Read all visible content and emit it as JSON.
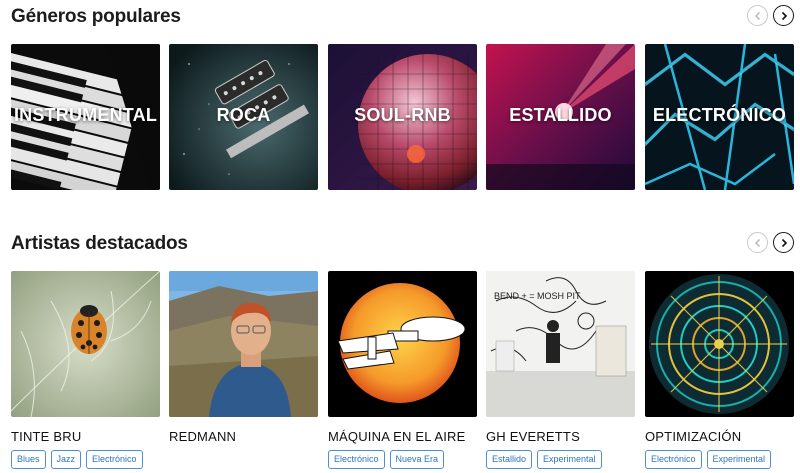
{
  "genres": {
    "title": "Géneros populares",
    "items": [
      {
        "label": "INSTRUMENTAL",
        "icon": "piano-image"
      },
      {
        "label": "ROCA",
        "icon": "guitar-image"
      },
      {
        "label": "SOUL-RNB",
        "icon": "disco-ball-image"
      },
      {
        "label": "ESTALLIDO",
        "icon": "concert-light-image"
      },
      {
        "label": "ELECTRÓNICO",
        "icon": "neon-lines-image"
      }
    ]
  },
  "artists": {
    "title": "Artistas destacados",
    "items": [
      {
        "name": "TINTE BRU",
        "tags": [
          "Blues",
          "Jazz",
          "Electrónico"
        ],
        "icon": "ladybug-image"
      },
      {
        "name": "REDMANN",
        "tags": [],
        "icon": "portrait-image"
      },
      {
        "name": "MÁQUINA EN EL AIRE",
        "tags": [
          "Electrónico",
          "Nueva Era"
        ],
        "icon": "starship-image"
      },
      {
        "name": "GH EVERETTS",
        "tags": [
          "Estallido",
          "Experimental"
        ],
        "icon": "sketch-image"
      },
      {
        "name": "OPTIMIZACIÓN",
        "tags": [
          "Electrónico",
          "Experimental"
        ],
        "icon": "mandala-image"
      }
    ]
  },
  "colors": {
    "tag_border": "#4a8fd8",
    "tag_text": "#2f74c2"
  }
}
